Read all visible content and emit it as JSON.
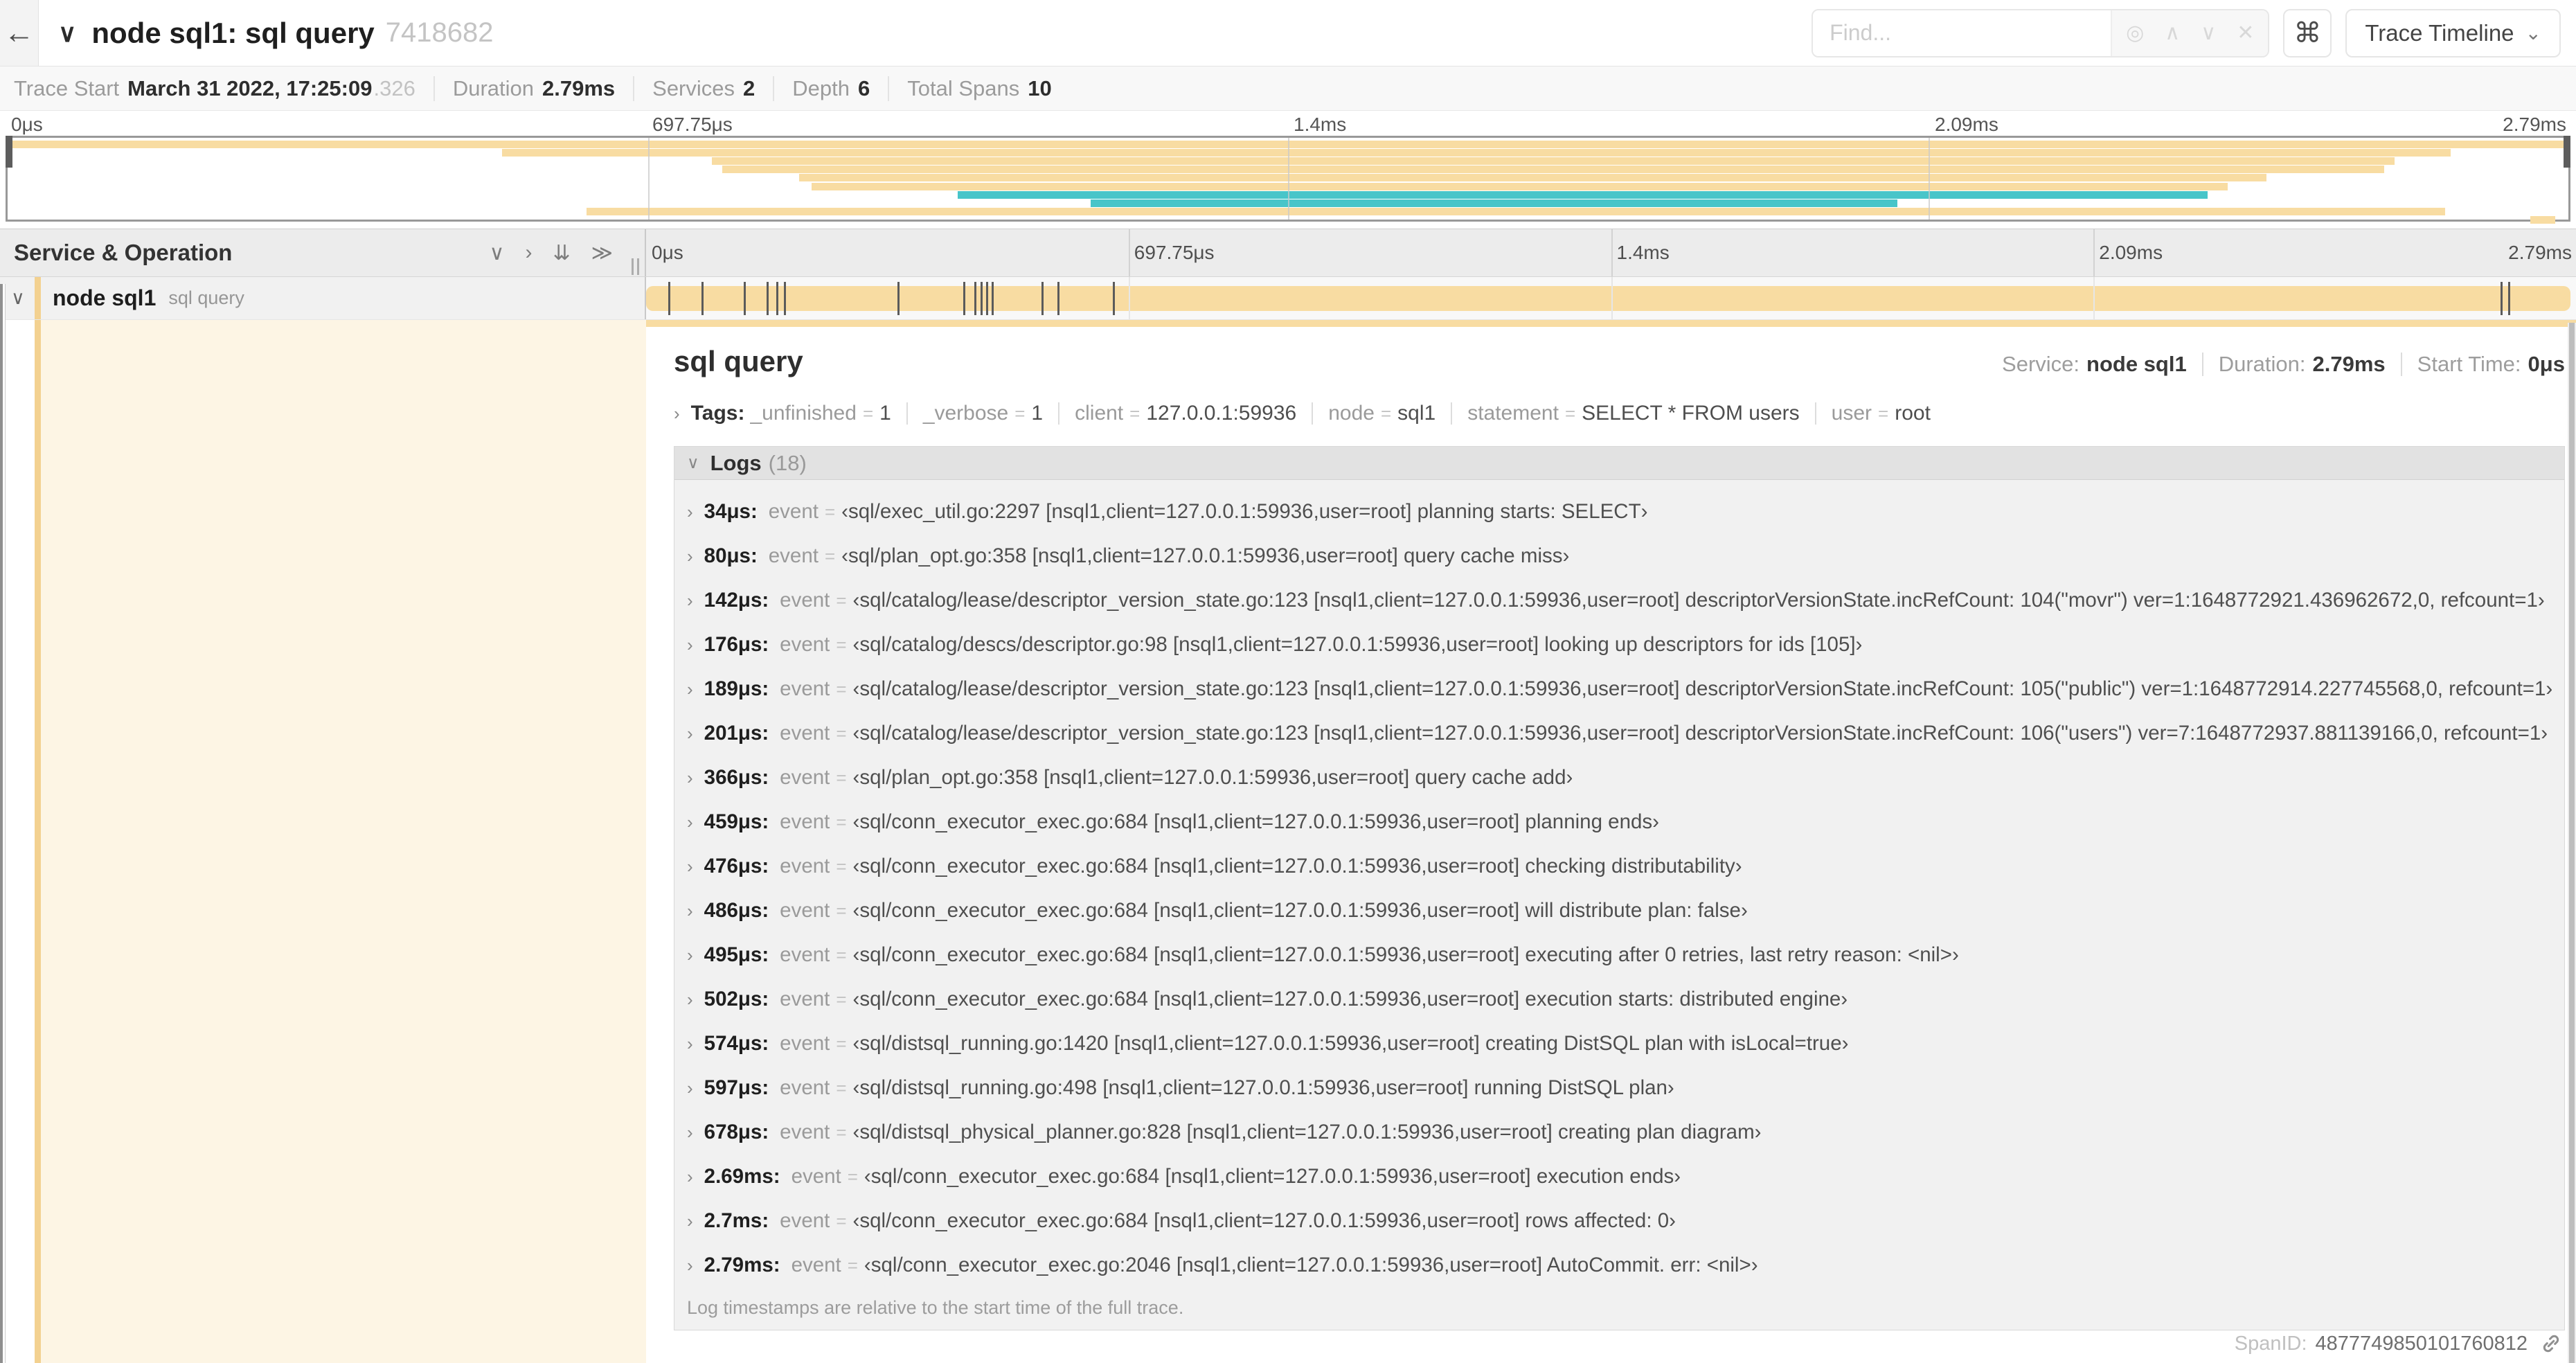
{
  "icons": {
    "back": "←",
    "collapse": "∨",
    "caret": "⌄",
    "chevron_right": "›",
    "chevron_down": "∨",
    "dbl_chevron_down": "⇊",
    "dbl_chevron_right": "≫",
    "up": "∧",
    "down": "∨",
    "clear": "✕",
    "crosshair": "◎",
    "command": "⌘"
  },
  "header": {
    "title": "node sql1: sql query",
    "trace_id": "7418682",
    "find_placeholder": "Find...",
    "view_select": "Trace Timeline"
  },
  "trace_meta": {
    "items": [
      {
        "label": "Trace Start",
        "value": "March 31 2022, 17:25:09",
        "suffix": ".326"
      },
      {
        "label": "Duration",
        "value": "2.79ms"
      },
      {
        "label": "Services",
        "value": "2"
      },
      {
        "label": "Depth",
        "value": "6"
      },
      {
        "label": "Total Spans",
        "value": "10"
      }
    ]
  },
  "timeline": {
    "left_header": "Service & Operation",
    "ticks": [
      "0μs",
      "697.75μs",
      "1.4ms",
      "2.09ms",
      "2.79ms"
    ]
  },
  "minimap": {
    "spans": [
      {
        "start": 0,
        "end": 100,
        "color": "amber"
      },
      {
        "start": 19.3,
        "end": 95.4,
        "color": "amber"
      },
      {
        "start": 27.5,
        "end": 93.2,
        "color": "amber"
      },
      {
        "start": 27.9,
        "end": 92.8,
        "color": "amber"
      },
      {
        "start": 30.9,
        "end": 88.2,
        "color": "amber"
      },
      {
        "start": 31.4,
        "end": 86.7,
        "color": "amber"
      },
      {
        "start": 37.1,
        "end": 85.9,
        "color": "teal"
      },
      {
        "start": 42.3,
        "end": 73.8,
        "color": "teal"
      },
      {
        "start": 22.6,
        "end": 95.2,
        "color": "amber"
      },
      {
        "start": 98.5,
        "end": 99.5,
        "color": "amber"
      }
    ]
  },
  "row": {
    "service": "node sql1",
    "operation": "sql query",
    "tick_pcts": [
      1.2,
      2.9,
      5.1,
      6.3,
      6.8,
      7.2,
      13.1,
      16.5,
      17.1,
      17.4,
      17.7,
      18.0,
      20.6,
      21.4,
      24.3,
      96.4,
      96.8
    ]
  },
  "detail": {
    "title": "sql query",
    "service_label": "Service:",
    "service": "node sql1",
    "duration_label": "Duration:",
    "duration": "2.79ms",
    "start_label": "Start Time:",
    "start": "0μs",
    "tags": {
      "label": "Tags:",
      "items": [
        {
          "key": "_unfinished",
          "value": "1"
        },
        {
          "key": "_verbose",
          "value": "1"
        },
        {
          "key": "client",
          "value": "127.0.0.1:59936"
        },
        {
          "key": "node",
          "value": "sql1"
        },
        {
          "key": "statement",
          "value": "SELECT * FROM users"
        },
        {
          "key": "user",
          "value": "root"
        }
      ]
    },
    "logs": {
      "label": "Logs",
      "count": "(18)",
      "key": "event",
      "entries": [
        {
          "time": "34μs",
          "value": "sql/exec_util.go:2297 [nsql1,client=127.0.0.1:59936,user=root] planning starts: SELECT"
        },
        {
          "time": "80μs",
          "value": "sql/plan_opt.go:358 [nsql1,client=127.0.0.1:59936,user=root] query cache miss"
        },
        {
          "time": "142μs",
          "value": "sql/catalog/lease/descriptor_version_state.go:123 [nsql1,client=127.0.0.1:59936,user=root] descriptorVersionState.incRefCount: 104(\"movr\") ver=1:1648772921.436962672,0, refcount=1"
        },
        {
          "time": "176μs",
          "value": "sql/catalog/descs/descriptor.go:98 [nsql1,client=127.0.0.1:59936,user=root] looking up descriptors for ids [105]"
        },
        {
          "time": "189μs",
          "value": "sql/catalog/lease/descriptor_version_state.go:123 [nsql1,client=127.0.0.1:59936,user=root] descriptorVersionState.incRefCount: 105(\"public\") ver=1:1648772914.227745568,0, refcount=1"
        },
        {
          "time": "201μs",
          "value": "sql/catalog/lease/descriptor_version_state.go:123 [nsql1,client=127.0.0.1:59936,user=root] descriptorVersionState.incRefCount: 106(\"users\") ver=7:1648772937.881139166,0, refcount=1"
        },
        {
          "time": "366μs",
          "value": "sql/plan_opt.go:358 [nsql1,client=127.0.0.1:59936,user=root] query cache add"
        },
        {
          "time": "459μs",
          "value": "sql/conn_executor_exec.go:684 [nsql1,client=127.0.0.1:59936,user=root] planning ends"
        },
        {
          "time": "476μs",
          "value": "sql/conn_executor_exec.go:684 [nsql1,client=127.0.0.1:59936,user=root] checking distributability"
        },
        {
          "time": "486μs",
          "value": "sql/conn_executor_exec.go:684 [nsql1,client=127.0.0.1:59936,user=root] will distribute plan: false"
        },
        {
          "time": "495μs",
          "value": "sql/conn_executor_exec.go:684 [nsql1,client=127.0.0.1:59936,user=root] executing after 0 retries, last retry reason: <nil>"
        },
        {
          "time": "502μs",
          "value": "sql/conn_executor_exec.go:684 [nsql1,client=127.0.0.1:59936,user=root] execution starts: distributed engine"
        },
        {
          "time": "574μs",
          "value": "sql/distsql_running.go:1420 [nsql1,client=127.0.0.1:59936,user=root] creating DistSQL plan with isLocal=true"
        },
        {
          "time": "597μs",
          "value": "sql/distsql_running.go:498 [nsql1,client=127.0.0.1:59936,user=root] running DistSQL plan"
        },
        {
          "time": "678μs",
          "value": "sql/distsql_physical_planner.go:828 [nsql1,client=127.0.0.1:59936,user=root] creating plan diagram"
        },
        {
          "time": "2.69ms",
          "value": "sql/conn_executor_exec.go:684 [nsql1,client=127.0.0.1:59936,user=root] execution ends"
        },
        {
          "time": "2.7ms",
          "value": "sql/conn_executor_exec.go:684 [nsql1,client=127.0.0.1:59936,user=root] rows affected: 0"
        },
        {
          "time": "2.79ms",
          "value": "sql/conn_executor_exec.go:2046 [nsql1,client=127.0.0.1:59936,user=root] AutoCommit. err: <nil>"
        }
      ],
      "footer": "Log timestamps are relative to the start time of the full trace."
    },
    "span_id_label": "SpanID:",
    "span_id": "4877749850101760812"
  },
  "colors": {
    "amber": "#f8dca2",
    "amber_strip": "#f3d190",
    "teal": "#48c5c9",
    "cream": "#fdf5e4",
    "tick": "#5b5b5b"
  }
}
